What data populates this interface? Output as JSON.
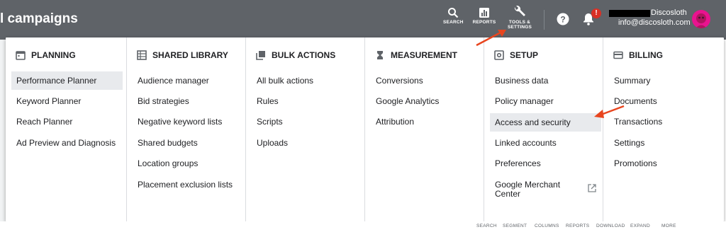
{
  "header": {
    "title": "l campaigns",
    "tools": [
      {
        "label": "SEARCH",
        "icon": "search-icon"
      },
      {
        "label": "REPORTS",
        "icon": "reports-icon"
      },
      {
        "label": "TOOLS & SETTINGS",
        "icon": "wrench-icon"
      }
    ],
    "notification_badge": "!",
    "account_name": "Discosloth",
    "account_email": "info@discosloth.com"
  },
  "menu": {
    "columns": [
      {
        "heading": "PLANNING",
        "icon": "calendar-icon",
        "items": [
          "Performance Planner",
          "Keyword Planner",
          "Reach Planner",
          "Ad Preview and Diagnosis"
        ]
      },
      {
        "heading": "SHARED LIBRARY",
        "icon": "library-grid-icon",
        "items": [
          "Audience manager",
          "Bid strategies",
          "Negative keyword lists",
          "Shared budgets",
          "Location groups",
          "Placement exclusion lists"
        ]
      },
      {
        "heading": "BULK ACTIONS",
        "icon": "copy-stack-icon",
        "items": [
          "All bulk actions",
          "Rules",
          "Scripts",
          "Uploads"
        ]
      },
      {
        "heading": "MEASUREMENT",
        "icon": "hourglass-icon",
        "items": [
          "Conversions",
          "Google Analytics",
          "Attribution"
        ]
      },
      {
        "heading": "SETUP",
        "icon": "gear-box-icon",
        "items": [
          "Business data",
          "Policy manager",
          "Access and security",
          "Linked accounts",
          "Preferences",
          "Google Merchant Center"
        ]
      },
      {
        "heading": "BILLING",
        "icon": "credit-card-icon",
        "items": [
          "Summary",
          "Documents",
          "Transactions",
          "Settings",
          "Promotions"
        ]
      }
    ],
    "active_item": "Performance Planner",
    "highlighted_item": "Access and security"
  },
  "bottom_toolbar": [
    "SEARCH",
    "SEGMENT",
    "COLUMNS",
    "REPORTS",
    "DOWNLOAD",
    "EXPAND",
    "MORE"
  ],
  "colors": {
    "topbar": "#5f6368",
    "arrow": "#e8451e",
    "badge": "#d93025",
    "avatar": "#e9138f"
  }
}
